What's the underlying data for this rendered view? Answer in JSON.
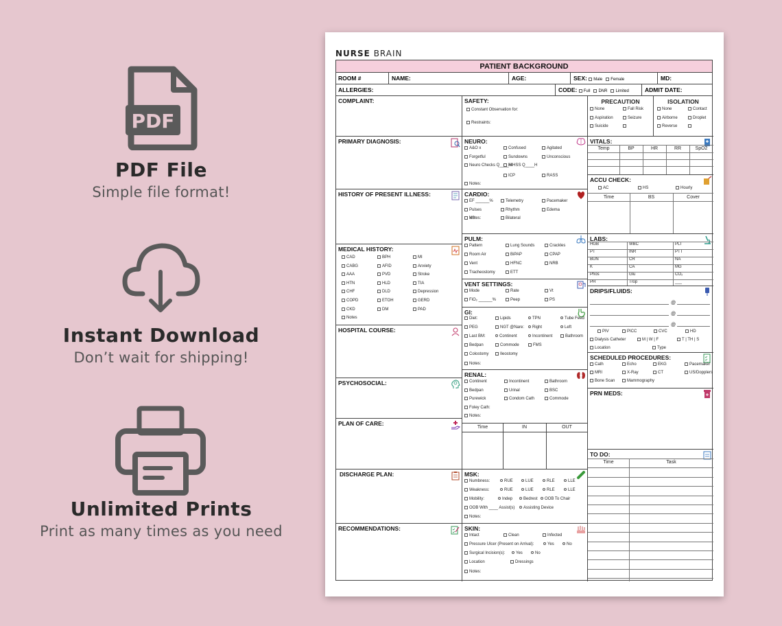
{
  "features": [
    {
      "icon": "pdf-file-icon",
      "icon_text": "PDF",
      "title": "PDF File",
      "subtitle": "Simple file format!"
    },
    {
      "icon": "cloud-download-icon",
      "title": "Instant Download",
      "subtitle": "Don’t wait for shipping!"
    },
    {
      "icon": "printer-icon",
      "title": "Unlimited Prints",
      "subtitle": "Print as many times as you need"
    }
  ],
  "brand": {
    "part1": "NURSE",
    "part2": " BRAIN"
  },
  "form": {
    "title": "PATIENT BACKGROUND",
    "row1": {
      "room": "ROOM #",
      "name": "NAME:",
      "age": "AGE:",
      "sex": "SEX:",
      "male": "Male",
      "female": "Female",
      "md": "MD:"
    },
    "row2": {
      "allergies": "ALLERGIES:",
      "code": "CODE:",
      "full": "Full",
      "dnr": "DNR",
      "limited": "Limited",
      "admit": "ADMIT DATE:"
    },
    "left": {
      "complaint": "COMPLAINT:",
      "primary": "PRIMARY DIAGNOSIS:",
      "hpi": "HISTORY OF PRESENT ILLNESS:",
      "medical": "MEDICAL HISTORY:",
      "medical_items": [
        "CAD",
        "BPH",
        "MI",
        "CABG",
        "AFID",
        "Anxiety",
        "AAA",
        "PVD",
        "Stroke",
        "HTN",
        "HLD",
        "TIA",
        "CHF",
        "DLD",
        "Depression",
        "COPD",
        "ETOH",
        "GERD",
        "CKD",
        "DM",
        "PAD",
        "Notes"
      ],
      "course": "HOSPITAL COURSE:",
      "psycho": "PSYCHOSOCIAL:",
      "plan": "PLAN OF CARE:",
      "discharge": "DISCHARGE PLAN:",
      "recs": "RECOMMENDATIONS:"
    },
    "mid": {
      "safety": "SAFETY:",
      "safety_items": [
        "Constant Observation for:",
        "Restraints:"
      ],
      "neuro": "NEURO:",
      "neuro_items": [
        "A&O x",
        "Confused",
        "Agitated",
        "Forgetful",
        "Sundowns",
        "Unconscious",
        "Neuro Checks Q____H",
        "NIHSS Q____H",
        "RASS",
        "ICP",
        "Notes:"
      ],
      "cardio": "CARDIO:",
      "cardio_items": [
        "EF ______%",
        "Telemetry",
        "Pacemaker",
        "Pulses",
        "Rhythm",
        "Edema",
        "VS",
        "Bilateral",
        "Notes:"
      ],
      "pulm": "PULM:",
      "pulm_items": [
        "Pattern",
        "Lung Sounds",
        "Crackles",
        "Room Air",
        "BiPAP",
        "CPAP",
        "Vent",
        "HFNC",
        "NRB",
        "Tracheostomy",
        "ETT"
      ],
      "vent": "VENT SETTINGS:",
      "vent_items": [
        "Mode",
        "Rate",
        "Vt",
        "FiO₂ ______%",
        "Peep",
        "PS"
      ],
      "gi": "GI:",
      "gi_items": [
        "Diet:",
        "Lipids",
        "TPN",
        "Tube Feed",
        "PEG",
        "NGT @Nare:",
        "Right",
        "Left",
        "Last BM:",
        "Continent",
        "Incontinent",
        "Bathroom",
        "Bedpan",
        "Commode",
        "FMS",
        "Colostomy",
        "Ileostomy",
        "Notes:"
      ],
      "renal": "RENAL:",
      "renal_items": [
        "Continent",
        "Incontinent",
        "Bathroom",
        "Bedpan",
        "Urinal",
        "BSC",
        "Purewick",
        "Condom Cath",
        "Commode",
        "Foley Cath:",
        "Notes:"
      ],
      "io": [
        "Time",
        "IN",
        "OUT"
      ],
      "msk": "MSK:",
      "msk_items": [
        "Numbness:",
        "RUE",
        "LUE",
        "RLE",
        "LLE",
        "Weakness:",
        "RUE",
        "LUE",
        "RLE",
        "LLE",
        "Mobility:",
        "Indep",
        "Bedrest",
        "OOB To Chair",
        "OOB With ____ Assist(s)",
        "Assisting Device",
        "Notes:"
      ],
      "skin": "SKIN:",
      "skin_items": [
        "Intact",
        "Clean",
        "Infected",
        "Pressure Ulcer (Present on Arrival):",
        "Yes",
        "No",
        "Surgical Incision(s):",
        "Yes",
        "No",
        "Location",
        "Dressings",
        "Notes:"
      ]
    },
    "right": {
      "precaution": "PRECAUTION",
      "isolation": "ISOLATION",
      "prec_items": [
        "None",
        "Fall Risk",
        "None",
        "Contact",
        "Aspiration",
        "Seizure",
        "Airborne",
        "Droplet",
        "Suicide",
        "",
        "Reverse",
        ""
      ],
      "vitals": "VITALS:",
      "vitals_cols": [
        "Temp",
        "BP",
        "HR",
        "RR",
        "SpO2"
      ],
      "accu": "ACCU CHECK:",
      "accu_opts": [
        "AC",
        "HS",
        "Hourly"
      ],
      "accu_cols": [
        "Time",
        "BS",
        "Cover"
      ],
      "labs": "LABS:",
      "labs_items": [
        "HGB",
        "WBC",
        "PLT",
        "PT",
        "INR",
        "PTT",
        "BUN",
        "CR",
        "NA",
        "K",
        "CA",
        "MG",
        "Phos",
        "Glu",
        "CO₂",
        "PH",
        "Trop",
        "___"
      ],
      "drips": "DRIPS/FLUIDS:",
      "drips_at": [
        "@",
        "@",
        "@"
      ],
      "lines": [
        "PIV",
        "PICC",
        "CVC",
        "HD",
        "Dialysis Catheter",
        "M | W | F",
        "T | TH | S",
        "Location",
        "Type"
      ],
      "sched": "SCHEDULED PROCEDURES:",
      "sched_items": [
        "Cath",
        "Echo",
        "EKG",
        "Pacemaker",
        "MRI",
        "X-Ray",
        "CT",
        "US/Dopplers",
        "Bone Scan",
        "Mammography"
      ],
      "prn": "PRN MEDS:",
      "todo": "TO DO:",
      "todo_cols": [
        "Time",
        "Task"
      ]
    }
  },
  "colors": {
    "background": "#e6c7cf",
    "header_pink": "#f6cfdc",
    "icon_gray": "#5a5a5a"
  }
}
